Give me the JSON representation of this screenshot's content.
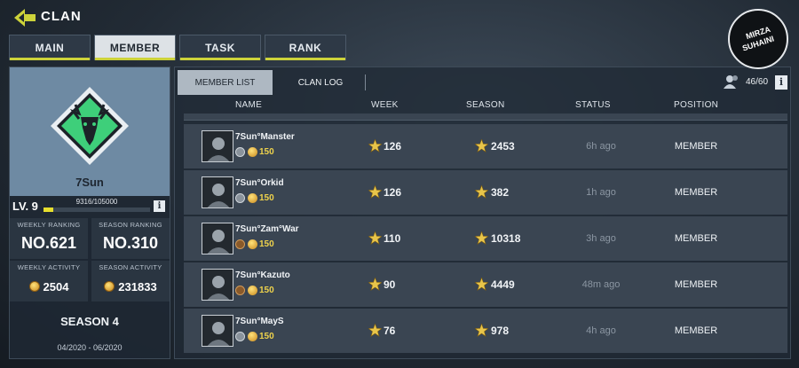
{
  "header": {
    "title": "CLAN"
  },
  "tabs": [
    {
      "label": "MAIN",
      "active": false
    },
    {
      "label": "MEMBER",
      "active": true
    },
    {
      "label": "TASK",
      "active": false
    },
    {
      "label": "RANK",
      "active": false
    }
  ],
  "clan": {
    "name": "7Sun",
    "level_label": "LV. 9",
    "xp_text": "9316/105000",
    "xp_progress": 0.0887,
    "weekly_ranking_label": "WEEKLY RANKING",
    "weekly_ranking": "NO.621",
    "season_ranking_label": "SEASON RANKING",
    "season_ranking": "NO.310",
    "weekly_activity_label": "WEEKLY ACTIVITY",
    "weekly_activity": "2504",
    "season_activity_label": "SEASON ACTIVITY",
    "season_activity": "231833",
    "season_title": "SEASON 4",
    "season_dates": "04/2020 - 06/2020",
    "emblem_color": "#3ecf7a"
  },
  "subtabs": {
    "member_list": "MEMBER LIST",
    "clan_log": "CLAN LOG"
  },
  "member_count": "46/60",
  "columns": {
    "name": "NAME",
    "week": "WEEK",
    "season": "SEASON",
    "status": "STATUS",
    "position": "POSITION"
  },
  "members": [
    {
      "name": "7Sun°Manster",
      "level": "150",
      "week": "126",
      "season": "2453",
      "status": "6h ago",
      "position": "MEMBER",
      "rank_badge": "silver"
    },
    {
      "name": "7Sun°Orkid",
      "level": "150",
      "week": "126",
      "season": "382",
      "status": "1h ago",
      "position": "MEMBER",
      "rank_badge": "silver"
    },
    {
      "name": "7Sun°Zam°War",
      "level": "150",
      "week": "110",
      "season": "10318",
      "status": "3h ago",
      "position": "MEMBER",
      "rank_badge": "bronze"
    },
    {
      "name": "7Sun°Kazuto",
      "level": "150",
      "week": "90",
      "season": "4449",
      "status": "48m ago",
      "position": "MEMBER",
      "rank_badge": "bronze"
    },
    {
      "name": "7Sun°MayS",
      "level": "150",
      "week": "76",
      "season": "978",
      "status": "4h ago",
      "position": "MEMBER",
      "rank_badge": "silver"
    }
  ],
  "watermark": {
    "line1": "MIRZA",
    "line2": "SUHAINI"
  },
  "colors": {
    "accent": "#cdd33a",
    "level_gold": "#eed24c",
    "status_grey": "#8b96a2"
  }
}
